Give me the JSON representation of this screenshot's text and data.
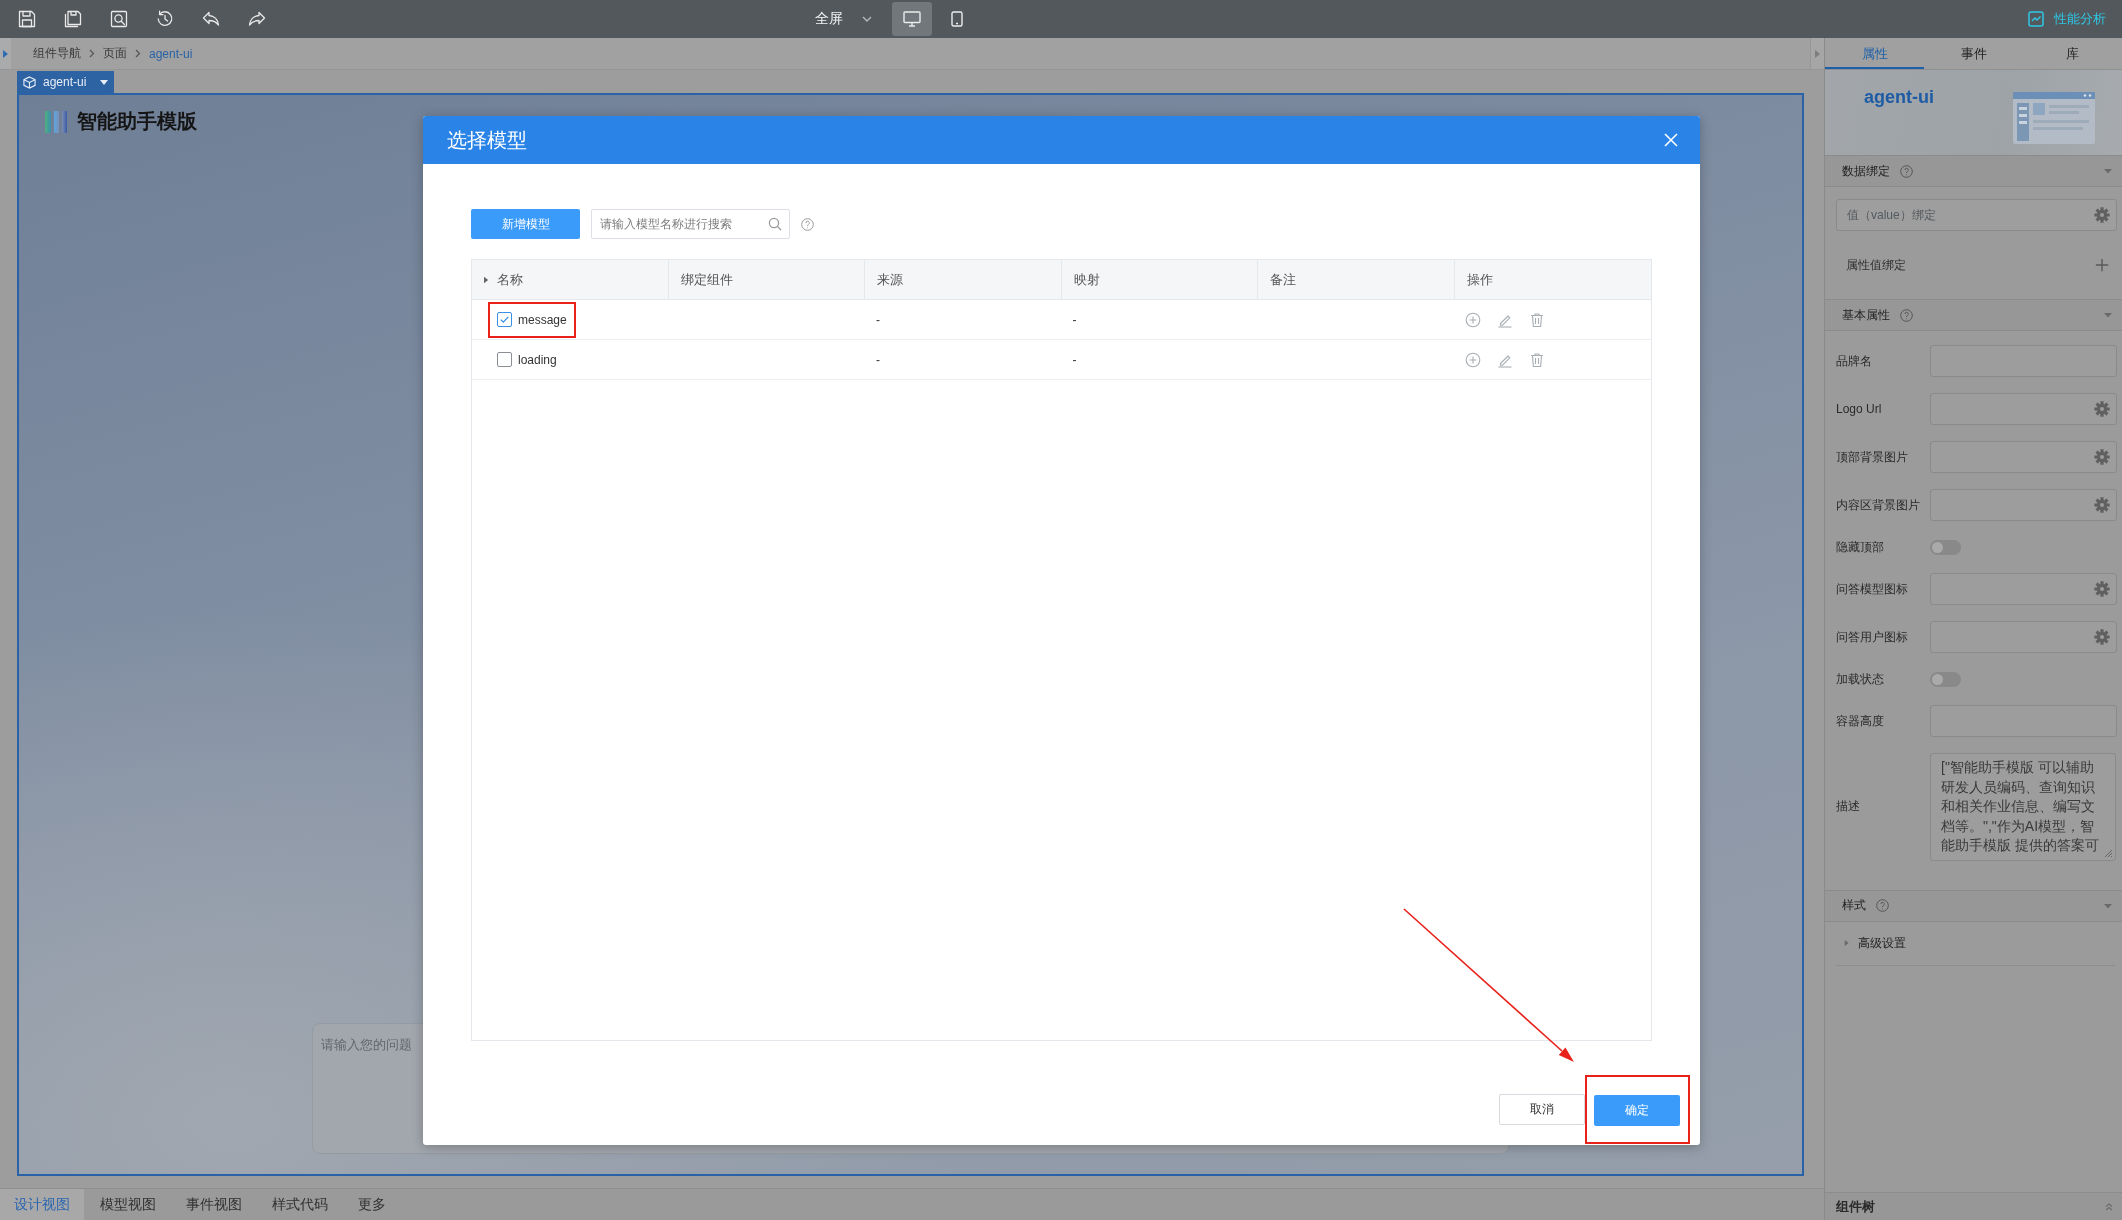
{
  "toolbar": {
    "screen_select": {
      "value": "全屏"
    },
    "view_modes": [
      {
        "selected": true
      },
      {
        "selected": false
      }
    ],
    "perf_link": "性能分析"
  },
  "breadcrumb": [
    "组件导航",
    "页面",
    "agent-ui"
  ],
  "canvas": {
    "component_tag": "agent-ui",
    "app_title": "智能助手模版",
    "chat_input": {
      "placeholder": "请输入您的问题"
    }
  },
  "bottom_tabs": [
    {
      "label": "设计视图",
      "selected": true
    },
    {
      "label": "模型视图",
      "selected": false
    },
    {
      "label": "事件视图",
      "selected": false
    },
    {
      "label": "样式代码",
      "selected": false
    },
    {
      "label": "更多",
      "selected": false
    }
  ],
  "right_panel": {
    "tabs": [
      {
        "label": "属性",
        "selected": true
      },
      {
        "label": "事件",
        "selected": false
      },
      {
        "label": "库",
        "selected": false
      }
    ],
    "component_name": "agent-ui",
    "data_binding": {
      "title": "数据绑定",
      "expanded": true,
      "value_binding": {
        "placeholder": "值（value）绑定"
      },
      "attribute_binding": "属性值绑定"
    },
    "basic_properties": {
      "title": "基本属性",
      "expanded": true,
      "rows": [
        {
          "label": "品牌名",
          "kind": "input"
        },
        {
          "label": "Logo Url",
          "kind": "picker"
        },
        {
          "label": "顶部背景图片",
          "kind": "picker"
        },
        {
          "label": "内容区背景图片",
          "kind": "picker"
        },
        {
          "label": "隐藏顶部",
          "kind": "toggle",
          "on": false
        },
        {
          "label": "问答模型图标",
          "kind": "picker"
        },
        {
          "label": "问答用户图标",
          "kind": "picker"
        },
        {
          "label": "加载状态",
          "kind": "toggle",
          "on": false
        },
        {
          "label": "容器高度",
          "kind": "input"
        },
        {
          "label": "描述",
          "kind": "textarea",
          "value": "[\"智能助手模版 可以辅助研发人员编码、查询知识和相关作业信息、编写文档等。\",\"作为AI模型，智能助手模版 提供的答案可"
        }
      ]
    },
    "style": {
      "title": "样式",
      "expanded": true,
      "groups": [
        {
          "label": "高级设置",
          "expanded": false
        }
      ]
    },
    "component_tree": {
      "title": "组件树",
      "expanded": false
    }
  },
  "dialog": {
    "title": "选择模型",
    "add_button": "新增模型",
    "search": {
      "placeholder": "请输入模型名称进行搜索"
    },
    "table": {
      "columns": [
        "名称",
        "绑定组件",
        "来源",
        "映射",
        "备注",
        "操作"
      ],
      "rows": [
        {
          "name": "message",
          "checked": true,
          "highlighted": true,
          "source": "-",
          "mapping": "-"
        },
        {
          "name": "loading",
          "checked": false,
          "highlighted": false,
          "source": "-",
          "mapping": "-"
        }
      ]
    },
    "buttons": [
      {
        "label": "取消",
        "kind": "default",
        "highlighted": false
      },
      {
        "label": "确定",
        "kind": "primary",
        "highlighted": true
      }
    ]
  }
}
